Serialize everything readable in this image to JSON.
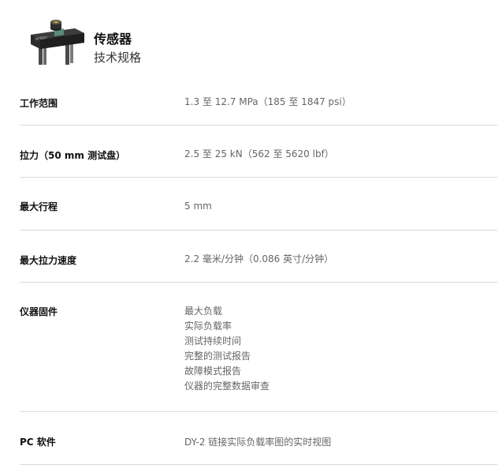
{
  "header": {
    "product_title": "传感器",
    "product_subtitle": "技术规格",
    "product_image_label": "DYTEST"
  },
  "specs": [
    {
      "label": "工作范围",
      "values": [
        "1.3 至 12.7 MPa（185 至 1847 psi）"
      ]
    },
    {
      "label": "拉力（50 mm 测试盘）",
      "values": [
        "2.5 至 25 kN（562 至 5620 lbf）"
      ]
    },
    {
      "label": "最大行程",
      "values": [
        "5 mm"
      ]
    },
    {
      "label": "最大拉力速度",
      "values": [
        "2.2 毫米/分钟（0.086 英寸/分钟）"
      ]
    },
    {
      "label": "仪器固件",
      "values": [
        "最大负载",
        "实际负载率",
        "测试持续时间",
        "完整的测试报告",
        "故障模式报告",
        "仪器的完整数据审查"
      ]
    },
    {
      "label": "PC 软件",
      "values": [
        "DY-2 链接实际负载率图的实时视图"
      ]
    }
  ]
}
